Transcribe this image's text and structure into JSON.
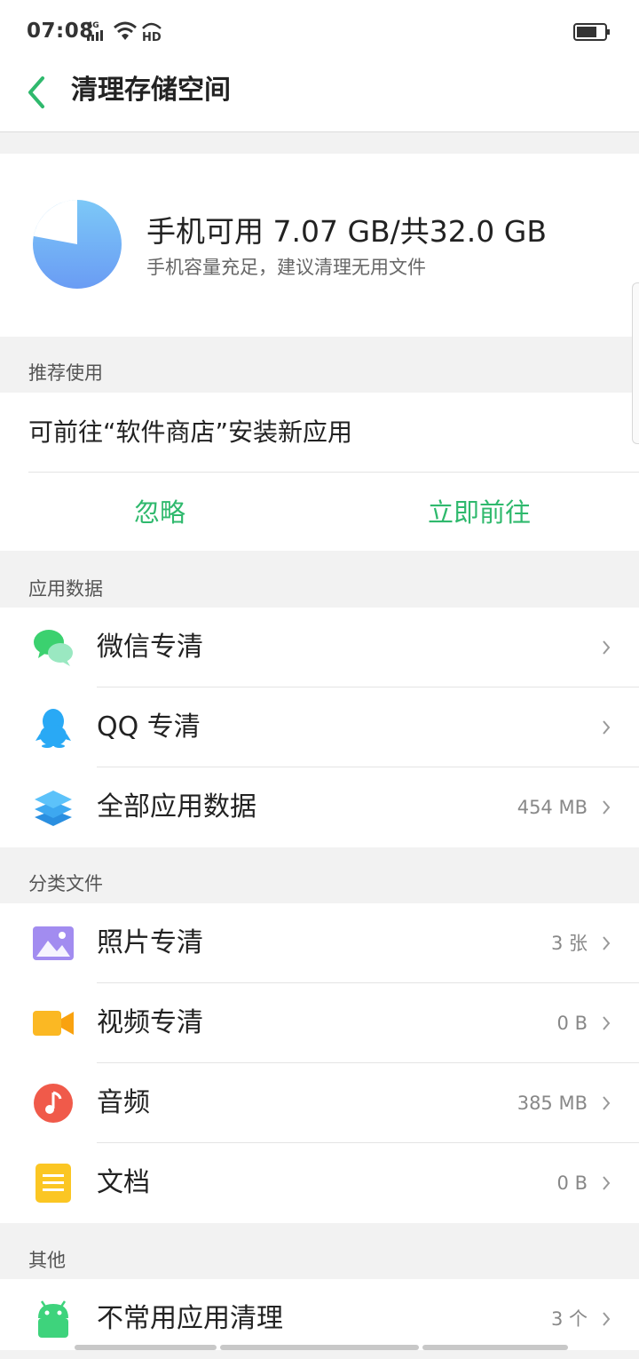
{
  "status_bar": {
    "time": "07:08",
    "network": "4G",
    "icons": [
      "signal-icon",
      "wifi-icon",
      "hd-icon",
      "battery-icon"
    ]
  },
  "header": {
    "title": "清理存储空间",
    "back_icon": "chevron-left-icon"
  },
  "storage": {
    "summary": "手机可用 7.07 GB/共32.0 GB",
    "hint": "手机容量充足，建议清理无用文件",
    "available_gb": 7.07,
    "total_gb": 32.0
  },
  "recommend": {
    "section_title": "推荐使用",
    "message": "可前往“软件商店”安装新应用",
    "ignore_label": "忽略",
    "go_label": "立即前往"
  },
  "app_data": {
    "section_title": "应用数据",
    "items": [
      {
        "label": "微信专清",
        "value": "",
        "icon": "wechat-icon"
      },
      {
        "label": "QQ 专清",
        "value": "",
        "icon": "qq-icon"
      },
      {
        "label": "全部应用数据",
        "value": "454 MB",
        "icon": "layers-icon"
      }
    ]
  },
  "categories": {
    "section_title": "分类文件",
    "items": [
      {
        "label": "照片专清",
        "value": "3 张",
        "icon": "photo-icon"
      },
      {
        "label": "视频专清",
        "value": "0 B",
        "icon": "video-icon"
      },
      {
        "label": "音频",
        "value": "385 MB",
        "icon": "music-icon"
      },
      {
        "label": "文档",
        "value": "0 B",
        "icon": "document-icon"
      }
    ]
  },
  "other": {
    "section_title": "其他",
    "items": [
      {
        "label": "不常用应用清理",
        "value": "3 个",
        "icon": "android-icon"
      }
    ]
  },
  "colors": {
    "accent": "#2fb96d",
    "background": "#f2f2f2"
  }
}
